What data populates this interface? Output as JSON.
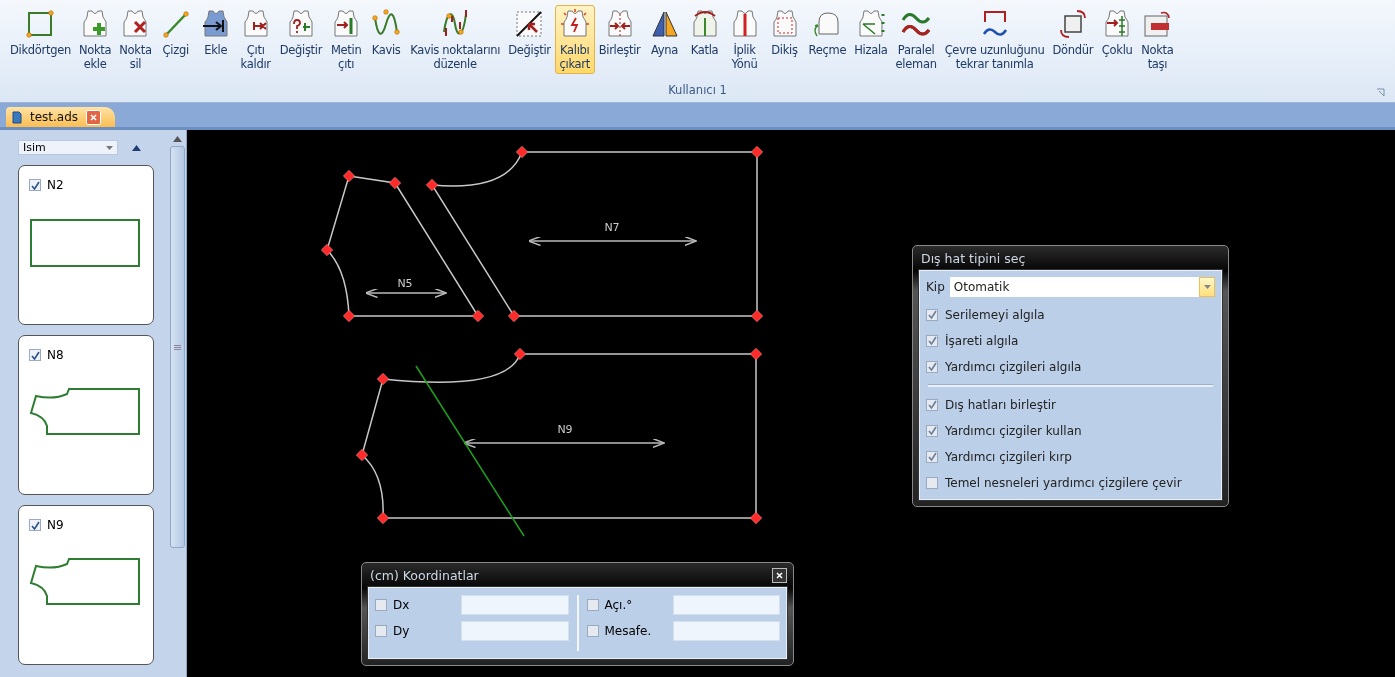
{
  "ribbon": {
    "group_label": "Kullanıcı 1",
    "tools": [
      {
        "lines": [
          "Dikdörtgen"
        ],
        "kind": "rectangle",
        "selected": false
      },
      {
        "lines": [
          "Nokta",
          "ekle"
        ],
        "kind": "vest-plus",
        "selected": false
      },
      {
        "lines": [
          "Nokta",
          "sil"
        ],
        "kind": "vest-cross",
        "selected": false
      },
      {
        "lines": [
          "Çizgi"
        ],
        "kind": "line",
        "selected": false
      },
      {
        "lines": [
          "Ekle"
        ],
        "kind": "vest-blue",
        "selected": false
      },
      {
        "lines": [
          "Çıtı",
          "kaldır"
        ],
        "kind": "vest-notch",
        "selected": false
      },
      {
        "lines": [
          "Değiştir"
        ],
        "kind": "vest-question",
        "selected": false
      },
      {
        "lines": [
          "Metin",
          "çıtı"
        ],
        "kind": "vest-text",
        "selected": false
      },
      {
        "lines": [
          "Kavis"
        ],
        "kind": "curve",
        "selected": false
      },
      {
        "lines": [
          "Kavis noktalarını",
          "düzenle"
        ],
        "kind": "curve-points",
        "selected": false
      },
      {
        "lines": [
          "Değiştir"
        ],
        "kind": "corner",
        "selected": false
      },
      {
        "lines": [
          "Kalıbı",
          "çıkart"
        ],
        "kind": "vest-burst",
        "selected": true
      },
      {
        "lines": [
          "Birleştir"
        ],
        "kind": "vest-arrows",
        "selected": false
      },
      {
        "lines": [
          "Ayna"
        ],
        "kind": "triangles",
        "selected": false
      },
      {
        "lines": [
          "Katla"
        ],
        "kind": "vest-fold",
        "selected": false
      },
      {
        "lines": [
          "İplik",
          "Yönü"
        ],
        "kind": "vest-grain",
        "selected": false
      },
      {
        "lines": [
          "Dikiş"
        ],
        "kind": "vest-dashed",
        "selected": false
      },
      {
        "lines": [
          "Reçme"
        ],
        "kind": "hat",
        "selected": false
      },
      {
        "lines": [
          "Hizala"
        ],
        "kind": "vest-align",
        "selected": false
      },
      {
        "lines": [
          "Paralel",
          "eleman"
        ],
        "kind": "waves",
        "selected": false
      },
      {
        "lines": [
          "Çevre uzunluğunu",
          "tekrar tanımla"
        ],
        "kind": "bracket-wave",
        "selected": false
      },
      {
        "lines": [
          "Döndür"
        ],
        "kind": "rotate",
        "selected": false
      },
      {
        "lines": [
          "Çoklu"
        ],
        "kind": "vest-multi",
        "selected": false
      },
      {
        "lines": [
          "Nokta",
          "taşı"
        ],
        "kind": "move",
        "selected": false
      }
    ]
  },
  "document_tabs": [
    {
      "label": "test.ads",
      "selected": true
    }
  ],
  "piece_list": {
    "sort_by": "Isim",
    "items": [
      {
        "name": "N2",
        "checked": true,
        "kind": "rectangle"
      },
      {
        "name": "N8",
        "checked": true,
        "kind": "bodice"
      },
      {
        "name": "N9",
        "checked": true,
        "kind": "bodice"
      }
    ]
  },
  "canvas": {
    "pieces": [
      {
        "label": "N5",
        "kind": "sleeve"
      },
      {
        "label": "N7",
        "kind": "front"
      },
      {
        "label": "N9",
        "kind": "back"
      }
    ]
  },
  "outline_dialog": {
    "title": "Dış hat tipini seç",
    "mode_label": "Kip",
    "mode_value": "Otomatik",
    "groups": [
      [
        {
          "label": "Serilemeyi algıla",
          "checked": true
        },
        {
          "label": "İşareti algıla",
          "checked": true
        },
        {
          "label": "Yardımcı çizgileri algıla",
          "checked": true
        }
      ],
      [
        {
          "label": "Dış hatları birleştir",
          "checked": true
        },
        {
          "label": "Yardımcı çizgiler kullan",
          "checked": true
        },
        {
          "label": "Yardımcı çizgileri kırp",
          "checked": true
        },
        {
          "label": "Temel nesneleri yardımcı çizgilere çevir",
          "checked": false
        }
      ]
    ]
  },
  "coordinates_panel": {
    "title": "(cm) Koordinatlar",
    "columns": [
      [
        {
          "label": "Dx",
          "checked": false
        },
        {
          "label": "Dy",
          "checked": false
        }
      ],
      [
        {
          "label": "Açı.°",
          "checked": false
        },
        {
          "label": "Mesafe.",
          "checked": false
        }
      ]
    ]
  }
}
